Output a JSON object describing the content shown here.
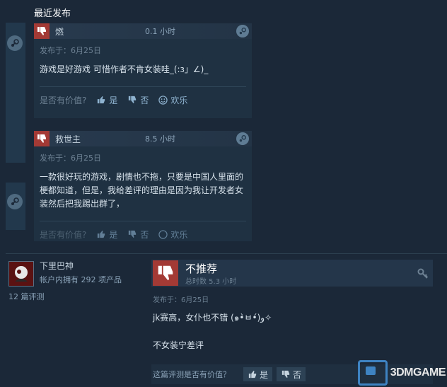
{
  "section_title": "最近发布",
  "reviews": [
    {
      "name": "燃",
      "hours": "0.1 小时",
      "posted": "发布于：6月25日",
      "text": "游戏是好游戏 可惜作者不肯女装哇_(:з」∠)_",
      "helpful_label": "是否有价值?",
      "yes": "是",
      "no": "否",
      "funny": "欢乐"
    },
    {
      "name": "救世主",
      "hours": "8.5 小时",
      "posted": "发布于：6月25日",
      "text": "一款很好玩的游戏，剧情也不拖，只要是中国人里面的梗都知道，但是，我给差评的理由是因为我让开发者女装然后把我踢出群了，",
      "helpful_label": "是否有价值?",
      "yes": "是",
      "no": "否",
      "funny": "欢乐"
    }
  ],
  "author": {
    "name": "下里巴神",
    "products": "帐户内拥有 292 项产品",
    "review_count": "12 篇评测"
  },
  "main_review": {
    "verdict": "不推荐",
    "hours": "总时数 5.3 小时",
    "posted": "发布于：6月25日",
    "line1": "jk赛高，女仆也不错 (๑•̀ㅂ•́)و✧",
    "line2": "不女装宁差评",
    "helpful_label": "这篇评测是否有价值？",
    "yes": "是",
    "no": "否"
  },
  "watermark": "3DMGAME",
  "colors": {
    "background": "#1b2838",
    "thumb_down": "#a33a35",
    "link": "#8fb3d0"
  }
}
